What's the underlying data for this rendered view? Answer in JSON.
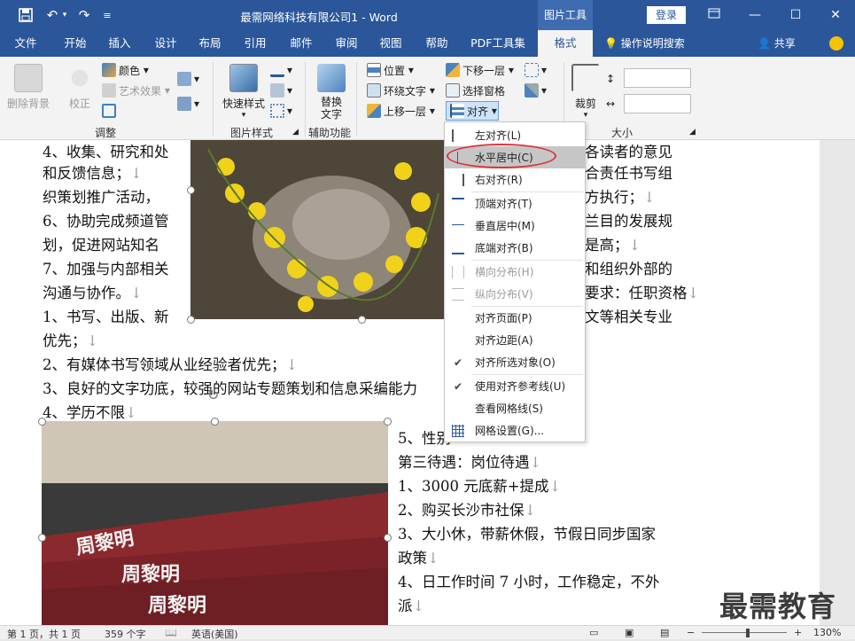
{
  "titlebar": {
    "doc_title": "最需网络科技有限公司1 - Word",
    "context_tab": "图片工具",
    "login": "登录"
  },
  "tabs": [
    "文件",
    "开始",
    "插入",
    "设计",
    "布局",
    "引用",
    "邮件",
    "审阅",
    "视图",
    "帮助",
    "PDF工具集",
    "格式"
  ],
  "tell_me": "操作说明搜索",
  "share": "共享",
  "ribbon": {
    "remove_bg": "删除背景",
    "correct": "校正",
    "color": "颜色",
    "art_effect": "艺术效果",
    "group_adjust": "调整",
    "quick_style": "快速样式",
    "group_pic_style": "图片样式",
    "alt_text": "替换\n文字",
    "group_access": "辅助功能",
    "position": "位置",
    "wrap_text": "环绕文字",
    "bring_forward": "上移一层",
    "send_backward": "下移一层",
    "select_pane": "选择窗格",
    "align": "对齐",
    "crop": "裁剪",
    "group_size": "大小"
  },
  "doc": {
    "l1a": "4、收集、研究和处",
    "l1b": "各读者的意见",
    "l2a": "和反馈信息；",
    "l2b": "合责任书写组",
    "l3a": "织策划推广活动，",
    "l3b": "方执行；",
    "l4a": "6、协助完成频道管",
    "l4b": "兰目的发展规",
    "l5a": "划，促进网站知名",
    "l5b": "是高；",
    "l6a": "7、加强与内部相关",
    "l6b": "和组织外部的",
    "l7a": "沟通与协作。",
    "l7b": "要求：任职资格",
    "l8a": "1、书写、出版、新",
    "l8b": "文等相关专业",
    "l9": "优先；",
    "l10": "2、有媒体书写领域从业经验者优先；",
    "l11": "3、良好的文字功底，较强的网站专题策划和信息采编能力",
    "l12": "4、学历不限",
    "r1": "5、性别",
    "r2": "第三待遇：岗位待遇",
    "r3": "1、3000 元底薪+提成",
    "r4": "2、购买长沙市社保",
    "r5": "3、大小休，带薪休假，节假日同步国家",
    "r6": "政策",
    "r7": "4、日工作时间 7 小时，工作稳定，不外",
    "r8": "派"
  },
  "align_menu": {
    "items": [
      {
        "label": "左对齐(L)",
        "disabled": false
      },
      {
        "label": "水平居中(C)",
        "disabled": false
      },
      {
        "label": "右对齐(R)",
        "disabled": false
      },
      {
        "label": "顶端对齐(T)",
        "disabled": false
      },
      {
        "label": "垂直居中(M)",
        "disabled": false
      },
      {
        "label": "底端对齐(B)",
        "disabled": false
      },
      {
        "label": "横向分布(H)",
        "disabled": true
      },
      {
        "label": "纵向分布(V)",
        "disabled": true
      },
      {
        "label": "对齐页面(P)",
        "disabled": false
      },
      {
        "label": "对齐边距(A)",
        "disabled": false
      },
      {
        "label": "对齐所选对象(O)",
        "disabled": false
      },
      {
        "label": "使用对齐参考线(U)",
        "disabled": false
      },
      {
        "label": "查看网格线(S)",
        "disabled": false
      },
      {
        "label": "网格设置(G)...",
        "disabled": false
      }
    ]
  },
  "status": {
    "page": "第 1 页，共 1 页",
    "words": "359 个字",
    "lang": "英语(美国)",
    "zoom": "130%"
  },
  "watermark": "最需教育",
  "colors": {
    "accent": "#2b579a",
    "highlight_circle": "#d9363e"
  }
}
